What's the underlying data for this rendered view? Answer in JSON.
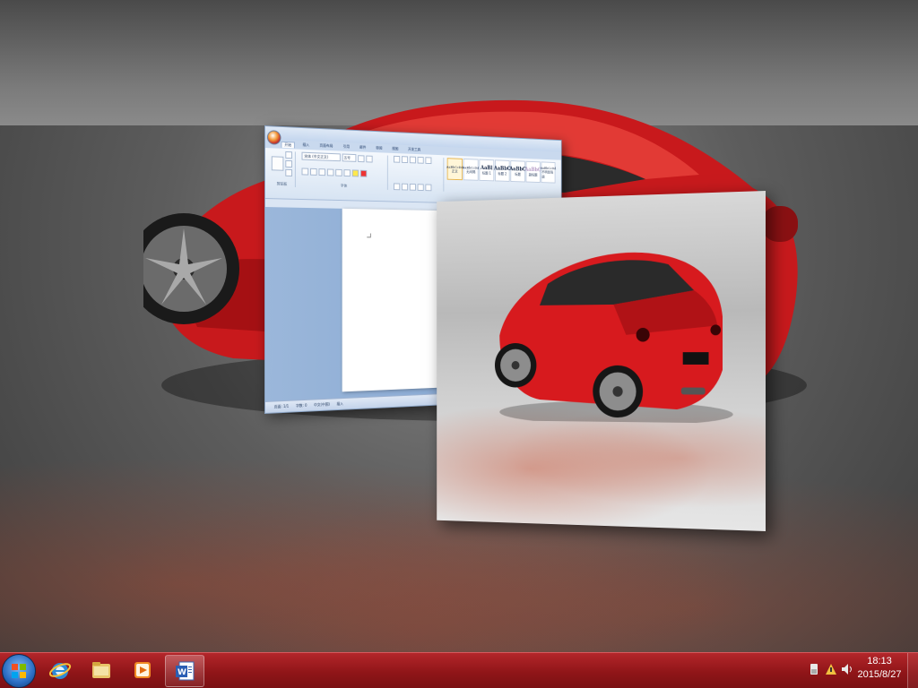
{
  "word_window": {
    "tabs": [
      "开始",
      "插入",
      "页面布局",
      "引用",
      "邮件",
      "审阅",
      "视图",
      "开发工具"
    ],
    "active_tab": "开始",
    "font_name": "宋体 (中文正文)",
    "font_size": "五号",
    "group_label_clipboard": "剪贴板",
    "group_label_font": "字体",
    "styles": [
      {
        "sample": "AaBbCcDd",
        "name": "正文"
      },
      {
        "sample": "AaBbCcDd",
        "name": "无间隔"
      },
      {
        "sample": "AaBl",
        "name": "标题 1"
      },
      {
        "sample": "AaBbC",
        "name": "标题 2"
      },
      {
        "sample": "AaBbC",
        "name": "标题"
      },
      {
        "sample": "AaBbC",
        "name": "副标题"
      },
      {
        "sample": "AaBbCcDd",
        "name": "不明显强调"
      }
    ],
    "status_items": [
      "页面: 1/1",
      "字数: 0",
      "中文(中国)",
      "插入"
    ]
  },
  "taskbar": {
    "pinned": [
      "internet-explorer",
      "windows-explorer",
      "media-player",
      "word"
    ],
    "active": "word",
    "clock_time": "18:13",
    "clock_date": "2015/8/27",
    "colors": {
      "taskbar": "#8f1518",
      "accent": "#b3262a"
    }
  }
}
